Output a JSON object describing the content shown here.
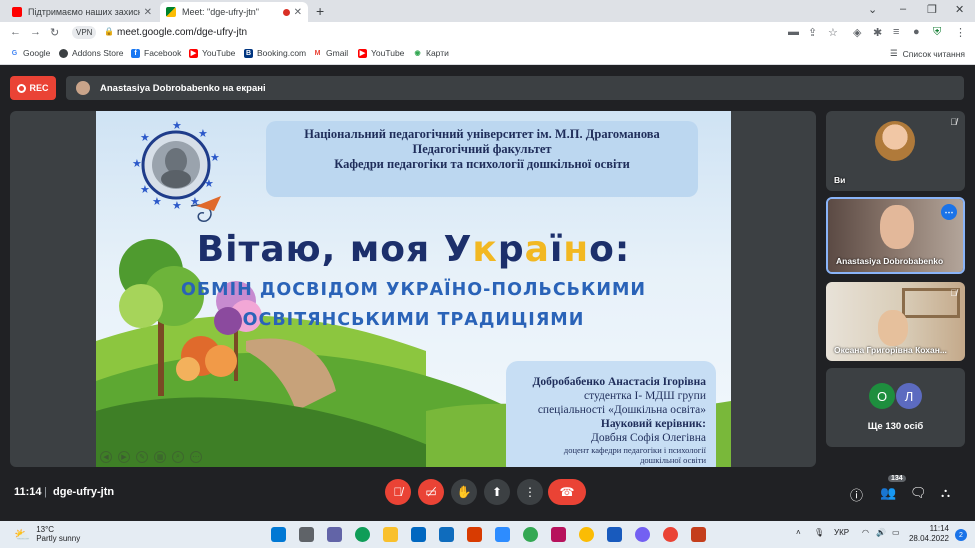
{
  "browser": {
    "tabs": [
      {
        "title": "Підтримаємо наших захисників",
        "active": false
      },
      {
        "title": "Meet: \"dge-ufry-jtn\"",
        "active": true
      }
    ],
    "vpn_label": "VPN",
    "url": "meet.google.com/dge-ufry-jtn",
    "bookmarks": [
      "Google",
      "Addons Store",
      "Facebook",
      "YouTube",
      "Booking.com",
      "Gmail",
      "YouTube",
      "Карти"
    ],
    "reading_list": "Список читання"
  },
  "meet": {
    "rec_label": "REC",
    "presenting_text": "Anastasiya Dobrobabenko на екрані",
    "meeting_time": "11:14",
    "meeting_code": "dge-ufry-jtn",
    "participants_badge": "134",
    "tiles": {
      "self_name": "Ви",
      "anastasiya_name": "Anastasiya Dobrobabenko",
      "oksana_name": "Оксана Григорівна Кохан...",
      "more_avatars": [
        "О",
        "Л"
      ],
      "more_text": "Ще 130 осіб"
    }
  },
  "slide": {
    "header_lines": [
      "Національний педагогічний університет ім. М.П. Драгоманова",
      "Педагогічний факультет",
      "Кафедри педагогіки та психології дошкільної освіти"
    ],
    "title_part1": "Вітаю, моя У",
    "title_k": "к",
    "title_r": "р",
    "title_a": "а",
    "title_i": "ї",
    "title_n": "н",
    "title_o": "о",
    "title_colon": ":",
    "subtitle_line1": "ОБМІН ДОСВІДОМ УКРАЇНО-ПОЛЬСЬКИМИ",
    "subtitle_line2": "ОСВІТЯНСЬКИМИ ТРАДИЦІЯМИ",
    "author_name": "Добробабенко Анастасія Ігорівна",
    "author_line2": "студентка І- МДШ групи",
    "author_line3": "спеціальності «Дошкільна освіта»",
    "supervisor_label": "Науковий керівник:",
    "supervisor_name": "Довбня Софія Олегівна",
    "supervisor_role_1": "доцент кафедри педагогіки і психології",
    "supervisor_role_2": "дошкільної освіти"
  },
  "taskbar": {
    "temperature": "13°C",
    "weather": "Partly sunny",
    "language": "УКР",
    "time": "11:14",
    "date": "28.04.2022",
    "notifications": "2"
  },
  "colors": {
    "meet_bg": "#202124",
    "tile_bg": "#3c4043",
    "red": "#ea4335",
    "accent": "#1a73e8",
    "slide_title": "#1c2f6b",
    "slide_sub": "#2a63b8"
  }
}
